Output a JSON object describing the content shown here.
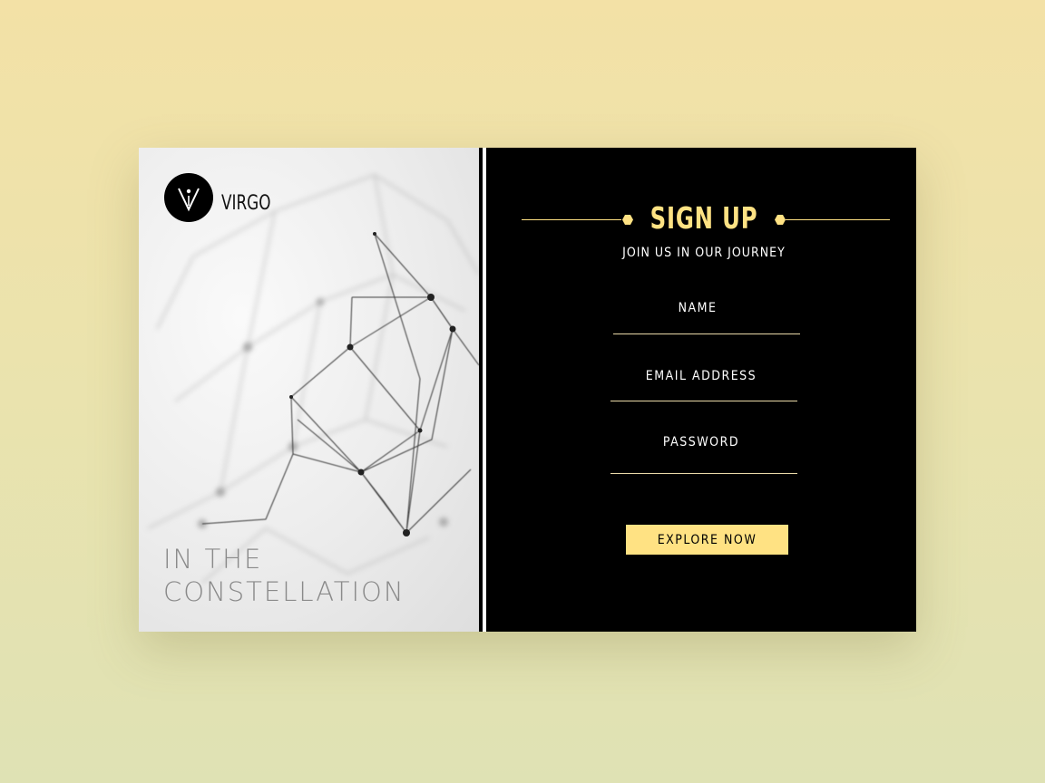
{
  "brand": {
    "name": "VIRGO",
    "logo_icon": "virgo-logo-icon"
  },
  "hero": {
    "line1": "IN THE",
    "line2": "CONSTELLATION"
  },
  "form": {
    "title": "SIGN UP",
    "subtitle": "JOIN US IN OUR JOURNEY",
    "fields": [
      {
        "label": "NAME"
      },
      {
        "label": "EMAIL ADDRESS"
      },
      {
        "label": "PASSWORD"
      }
    ],
    "submit_label": "EXPLORE NOW"
  },
  "colors": {
    "accent": "#ffe283",
    "panel": "#000000",
    "background": "#f0e2a8"
  }
}
